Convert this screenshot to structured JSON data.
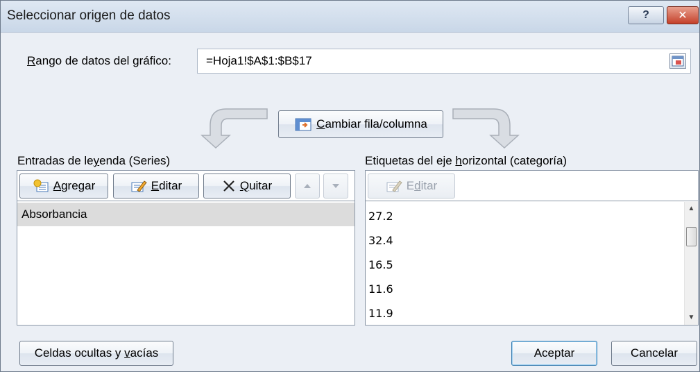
{
  "window": {
    "title": "Seleccionar origen de datos",
    "help_label": "?",
    "close_label": "✕"
  },
  "range": {
    "label_prefix": "",
    "label_underlined": "R",
    "label_rest": "ango de datos del gráfico:",
    "value": "=Hoja1!$A$1:$B$17"
  },
  "switch_button": {
    "underlined": "C",
    "rest": "ambiar fila/columna"
  },
  "legend_panel": {
    "title_prefix": "Entradas de le",
    "title_underlined": "y",
    "title_rest": "enda (Series)",
    "add": {
      "underlined": "A",
      "rest": "gregar"
    },
    "edit": {
      "underlined": "E",
      "rest": "ditar"
    },
    "remove": {
      "underlined": "Q",
      "rest": "uitar"
    },
    "items": [
      "Absorbancia"
    ]
  },
  "category_panel": {
    "title_prefix": "Etiquetas del eje ",
    "title_underlined": "h",
    "title_rest": "orizontal (categoría)",
    "edit": {
      "prefix": "E",
      "underlined": "d",
      "rest": "itar"
    },
    "items": [
      "27.2",
      "32.4",
      "16.5",
      "11.6",
      "11.9"
    ]
  },
  "footer": {
    "hidden_cells": {
      "prefix": "Celdas ocultas y ",
      "underlined": "v",
      "rest": "acías"
    },
    "ok": "Aceptar",
    "cancel": "Cancelar"
  },
  "icons": {
    "help": "help-icon",
    "close": "close-icon",
    "collapse": "collapse-dialog-icon",
    "switch": "switch-row-column-icon",
    "add": "add-series-icon",
    "edit": "edit-icon",
    "remove": "remove-x-icon",
    "up": "move-up-icon",
    "down": "move-down-icon"
  },
  "colors": {
    "dialog_bg": "#ebeff5",
    "close_red": "#c4402a",
    "selection_gray": "#dcdcdc"
  }
}
